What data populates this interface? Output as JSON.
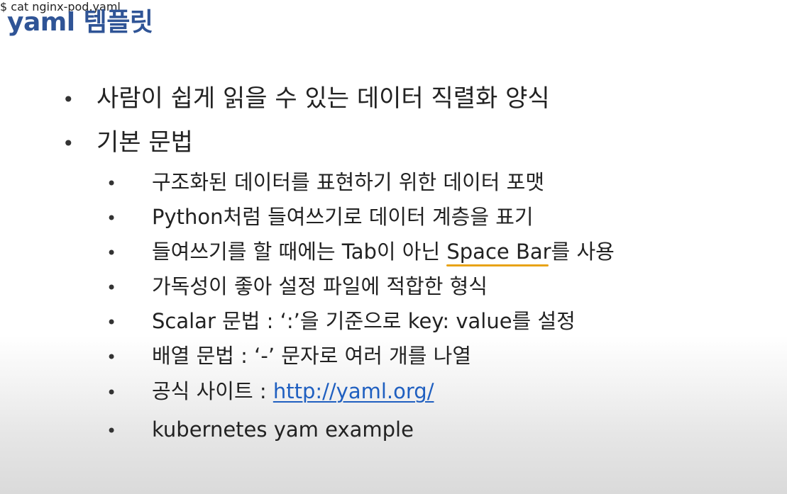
{
  "title": "yaml 템플릿",
  "bullets_l1": [
    "사람이 쉽게 읽을 수 있는 데이터 직렬화 양식",
    "기본 문법"
  ],
  "bullets_l2": [
    "구조화된 데이터를 표현하기 위한 데이터 포맷",
    "Python처럼 들여쓰기로 데이터 계층을 표기",
    {
      "prefix": "들여쓰기를 할 때에는 Tab이 아닌 ",
      "highlight": "Space Bar",
      "suffix": "를 사용"
    },
    "가독성이 좋아 설정 파일에 적합한 형식",
    "Scalar 문법 :  ‘:’을 기준으로 key: value를 설정",
    "배열 문법 : ‘-’ 문자로 여러 개를 나열",
    {
      "prefix": "공식 사이트 : ",
      "link": "http://yaml.org/"
    },
    "kubernetes yam example"
  ],
  "continuation": "$ cat nginx-pod.yaml",
  "bullet_char": "•",
  "colors": {
    "title": "#2f5496",
    "link": "#1f5fc0",
    "annotation": "#e8a317"
  }
}
